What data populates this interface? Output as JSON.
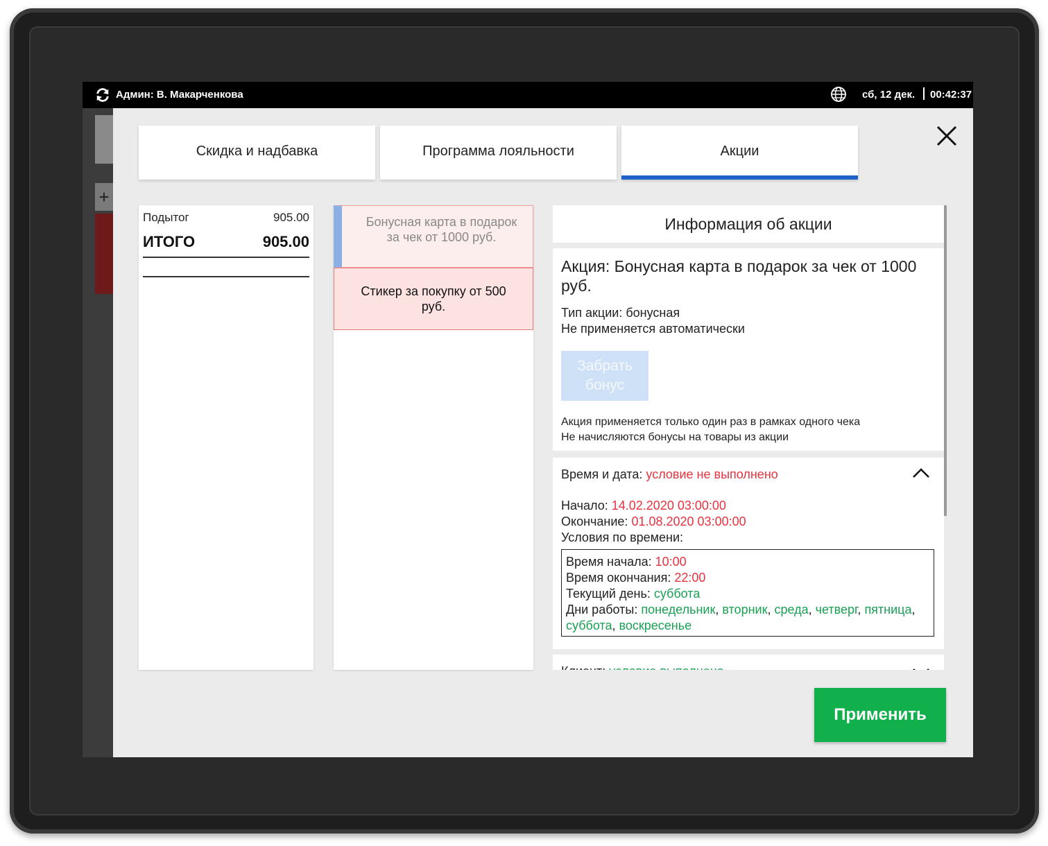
{
  "statusbar": {
    "admin": "Админ: В. Макарченкова",
    "date": "сб, 12 дек.",
    "time": "00:42:37"
  },
  "tabs": [
    {
      "label": "Скидка и надбавка",
      "active": false
    },
    {
      "label": "Программа лояльности",
      "active": false
    },
    {
      "label": "Акции",
      "active": true
    }
  ],
  "totals": {
    "subtotal_label": "Подытог",
    "subtotal_value": "905.00",
    "total_label": "ИТОГО",
    "total_value": "905.00"
  },
  "promotions": [
    {
      "title": "Бонусная карта в подарок за чек от 1000 руб.",
      "selected": true
    },
    {
      "title": "Стикер за покупку от 500 руб.",
      "selected": false
    }
  ],
  "info": {
    "header": "Информация об акции",
    "name": "Акция: Бонусная карта в подарок за чек от 1000 руб.",
    "type": "Тип акции: бонусная",
    "auto": "Не применяется автоматически",
    "take_bonus": "Забрать бонус",
    "rule_once": "Акция применяется только один раз в рамках одного чека",
    "rule_no_bonus": "Не начисляются бонусы на товары из акции"
  },
  "time_condition": {
    "label": "Время и дата:",
    "status": "условие не выполнено",
    "start_label": "Начало:",
    "start_value": "14.02.2020 03:00:00",
    "end_label": "Окончание:",
    "end_value": "01.08.2020 03:00:00",
    "conditions_label": "Условия по времени:",
    "time_start_label": "Время начала:",
    "time_start_value": "10:00",
    "time_end_label": "Время окончания:",
    "time_end_value": "22:00",
    "current_day_label": "Текущий день:",
    "current_day_value": "суббота",
    "work_days_label": "Дни работы:",
    "work_days": [
      "понедельник",
      "вторник",
      "среда",
      "четверг",
      "пятница",
      "суббота",
      "воскресенье"
    ]
  },
  "client_condition": {
    "label": "Клиент:",
    "status": "условие выполнено"
  },
  "apply_label": "Применить",
  "colors": {
    "accent": "#1e62c8",
    "apply": "#12b04d",
    "fail": "#e8333f",
    "ok": "#1aa055"
  }
}
